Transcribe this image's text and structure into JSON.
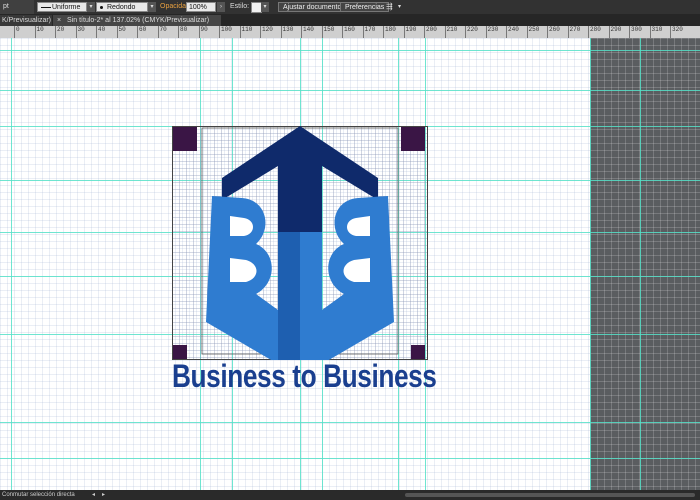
{
  "control_bar": {
    "unit_value": "pt",
    "stroke_profile": "Uniforme",
    "brush": "Redondo 5...",
    "opacity_label": "Opacidad:",
    "opacity_value": "100%",
    "style_label": "Estilo:",
    "adjust_doc_label": "Ajustar documento",
    "preferences_label": "Preferencias",
    "accent_color": "#e8a040"
  },
  "tabs": [
    {
      "label": "K/Previsualizar)"
    },
    {
      "label": "Sin título-2* al 137.02% (CMYK/Previsualizar)",
      "close": "×"
    }
  ],
  "ruler": {
    "labels": [
      "0",
      "10",
      "20",
      "30",
      "40",
      "50",
      "60",
      "70",
      "80",
      "90",
      "100",
      "110",
      "120",
      "130",
      "140",
      "150",
      "160",
      "170",
      "180",
      "190",
      "200",
      "210",
      "220",
      "230",
      "240",
      "250",
      "260",
      "270",
      "280",
      "290",
      "300",
      "310",
      "320"
    ]
  },
  "artwork": {
    "monogram": "BTB",
    "tagline": "Business to Business",
    "colors": {
      "dark_navy": "#0f2a6b",
      "mid_blue": "#1e5fb0",
      "light_blue": "#2f7cd0",
      "corner_purple": "#3a1545",
      "text_blue": "#1a3f8f"
    }
  },
  "status_bar": {
    "tool_status": "Conmutar selección directa",
    "nav_prev": "◂",
    "nav_next": "▸"
  }
}
